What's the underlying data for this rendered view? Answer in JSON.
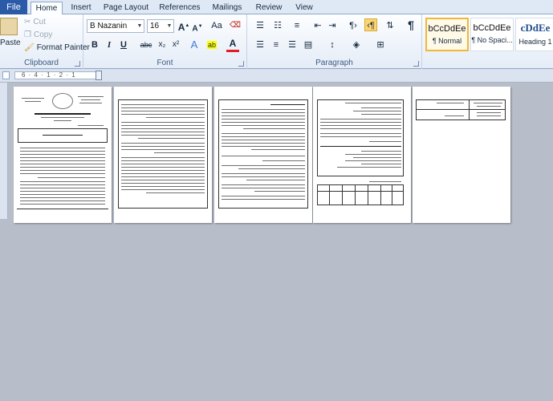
{
  "tabs": [
    "File",
    "Home",
    "Insert",
    "Page Layout",
    "References",
    "Mailings",
    "Review",
    "View"
  ],
  "active_tab": "Home",
  "clipboard": {
    "paste": "Paste",
    "cut": "Cut",
    "copy": "Copy",
    "format_painter": "Format Painter",
    "label": "Clipboard"
  },
  "font": {
    "name": "B Nazanin",
    "size": "16",
    "label": "Font",
    "grow": "A",
    "shrink": "A",
    "case": "Aa",
    "bold": "B",
    "italic": "I",
    "underline": "U",
    "strike": "abc",
    "subscript": "x₂",
    "superscript": "x²"
  },
  "paragraph": {
    "label": "Paragraph",
    "pilcrow": "¶"
  },
  "styles": [
    {
      "sample": "bCcDdEe",
      "name": "¶ Normal"
    },
    {
      "sample": "bCcDdEe",
      "name": "¶ No Spaci..."
    },
    {
      "sample": "cDdEe",
      "name": "Heading 1"
    }
  ],
  "ruler": {
    "ticks": "6 · 4 · 1 · 2 · 1"
  },
  "colors": {
    "file_tab": "#2a5aa8",
    "selected_button": "#fbd56f",
    "workspace": "#b7bec9"
  }
}
